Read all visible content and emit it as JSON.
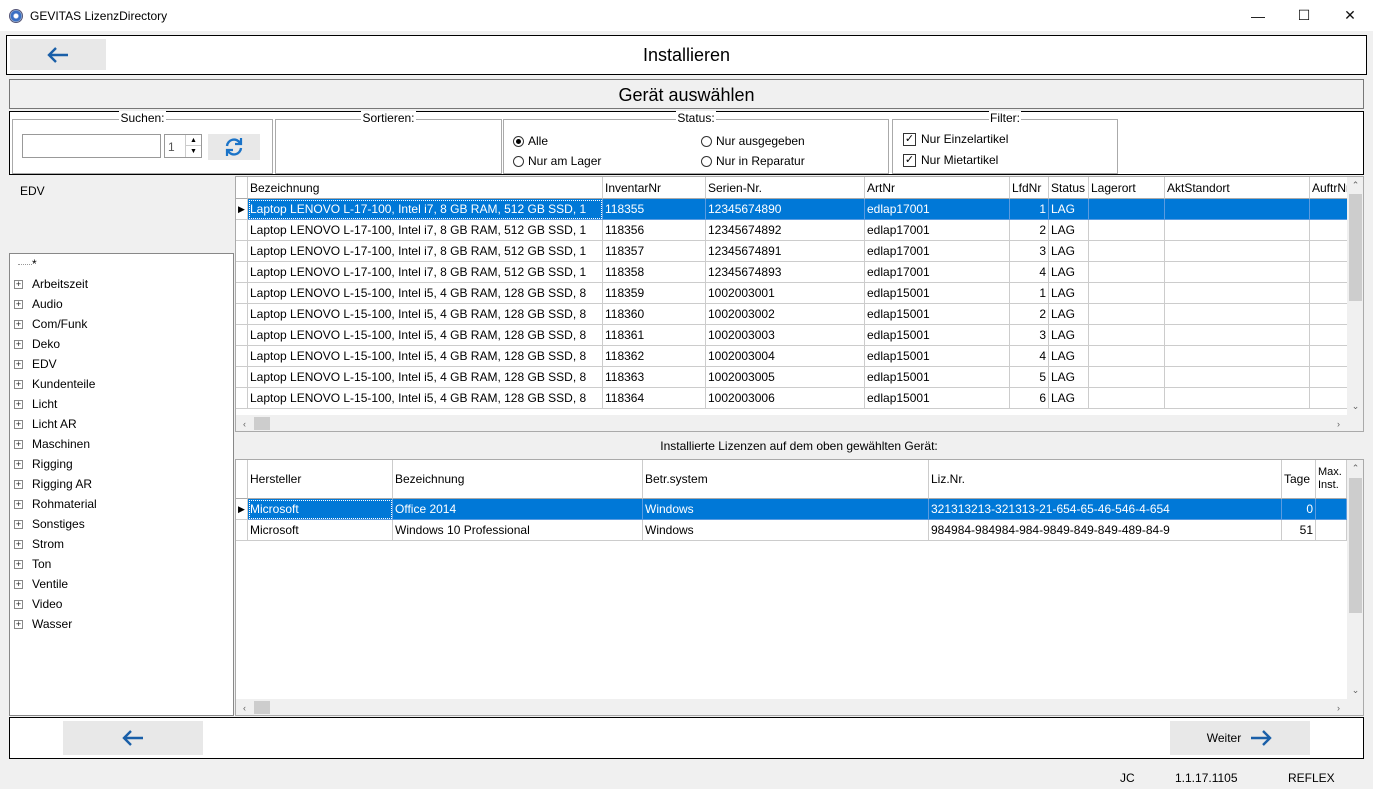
{
  "window": {
    "title": "GEVITAS LizenzDirectory",
    "minimize": "—",
    "maximize": "☐",
    "close": "✕"
  },
  "header": {
    "title": "Installieren",
    "back_icon": "arrow-left-icon"
  },
  "section": {
    "title": "Gerät auswählen"
  },
  "search": {
    "legend": "Suchen:",
    "value": "",
    "spin_value": "1",
    "refresh_icon": "refresh-icon"
  },
  "sort": {
    "legend": "Sortieren:"
  },
  "status": {
    "legend": "Status:",
    "options": [
      {
        "label": "Alle",
        "selected": true
      },
      {
        "label": "Nur ausgegeben",
        "selected": false
      },
      {
        "label": "Nur am Lager",
        "selected": false
      },
      {
        "label": "Nur in Reparatur",
        "selected": false
      }
    ]
  },
  "filter": {
    "legend": "Filter:",
    "options": [
      {
        "label": "Nur Einzelartikel",
        "checked": true
      },
      {
        "label": "Nur Mietartikel",
        "checked": true
      }
    ]
  },
  "category": {
    "selected_label": "EDV",
    "tree": [
      "*",
      "Arbeitszeit",
      "Audio",
      "Com/Funk",
      "Deko",
      "EDV",
      "Kundenteile",
      "Licht",
      "Licht AR",
      "Maschinen",
      "Rigging",
      "Rigging AR",
      "Rohmaterial",
      "Sonstiges",
      "Strom",
      "Ton",
      "Ventile",
      "Video",
      "Wasser"
    ]
  },
  "devices": {
    "columns": [
      "Bezeichnung",
      "InventarNr",
      "Serien-Nr.",
      "ArtNr",
      "LfdNr",
      "Status",
      "Lagerort",
      "AktStandort",
      "AuftrNr"
    ],
    "rows": [
      [
        "Laptop LENOVO L-17-100, Intel i7, 8 GB RAM, 512 GB SSD, 1",
        "118355",
        "12345674890",
        "edlap17001",
        "1",
        "LAG",
        "",
        "",
        ""
      ],
      [
        "Laptop LENOVO L-17-100, Intel i7, 8 GB RAM, 512 GB SSD, 1",
        "118356",
        "12345674892",
        "edlap17001",
        "2",
        "LAG",
        "",
        "",
        ""
      ],
      [
        "Laptop LENOVO L-17-100, Intel i7, 8 GB RAM, 512 GB SSD, 1",
        "118357",
        "12345674891",
        "edlap17001",
        "3",
        "LAG",
        "",
        "",
        ""
      ],
      [
        "Laptop LENOVO L-17-100, Intel i7, 8 GB RAM, 512 GB SSD, 1",
        "118358",
        "12345674893",
        "edlap17001",
        "4",
        "LAG",
        "",
        "",
        ""
      ],
      [
        "Laptop LENOVO L-15-100, Intel i5, 4 GB RAM, 128 GB SSD, 8",
        "118359",
        "1002003001",
        "edlap15001",
        "1",
        "LAG",
        "",
        "",
        ""
      ],
      [
        "Laptop LENOVO L-15-100, Intel i5, 4 GB RAM, 128 GB SSD, 8",
        "118360",
        "1002003002",
        "edlap15001",
        "2",
        "LAG",
        "",
        "",
        ""
      ],
      [
        "Laptop LENOVO L-15-100, Intel i5, 4 GB RAM, 128 GB SSD, 8",
        "118361",
        "1002003003",
        "edlap15001",
        "3",
        "LAG",
        "",
        "",
        ""
      ],
      [
        "Laptop LENOVO L-15-100, Intel i5, 4 GB RAM, 128 GB SSD, 8",
        "118362",
        "1002003004",
        "edlap15001",
        "4",
        "LAG",
        "",
        "",
        ""
      ],
      [
        "Laptop LENOVO L-15-100, Intel i5, 4 GB RAM, 128 GB SSD, 8",
        "118363",
        "1002003005",
        "edlap15001",
        "5",
        "LAG",
        "",
        "",
        ""
      ],
      [
        "Laptop LENOVO L-15-100, Intel i5, 4 GB RAM, 128 GB SSD, 8",
        "118364",
        "1002003006",
        "edlap15001",
        "6",
        "LAG",
        "",
        "",
        ""
      ]
    ],
    "selected_row": 0
  },
  "licenses": {
    "caption": "Installierte Lizenzen auf dem oben gewählten Gerät:",
    "columns": [
      "Hersteller",
      "Bezeichnung",
      "Betr.system",
      "Liz.Nr.",
      "Tage",
      "Max. Inst."
    ],
    "rows": [
      [
        "Microsoft",
        "Office 2014",
        "Windows",
        "321313213-321313-21-654-65-46-546-4-654",
        "0",
        ""
      ],
      [
        "Microsoft",
        "Windows 10 Professional",
        "Windows",
        "984984-984984-984-9849-849-849-489-84-9",
        "51",
        ""
      ]
    ],
    "selected_row": 0
  },
  "footer": {
    "next_label": "Weiter",
    "back_icon": "arrow-left-icon",
    "next_icon": "arrow-right-icon"
  },
  "statusbar": {
    "user": "JC",
    "version": "1.1.17.1105",
    "database": "REFLEX"
  },
  "colors": {
    "accent": "#0078d7",
    "arrow": "#1a5fa8"
  }
}
